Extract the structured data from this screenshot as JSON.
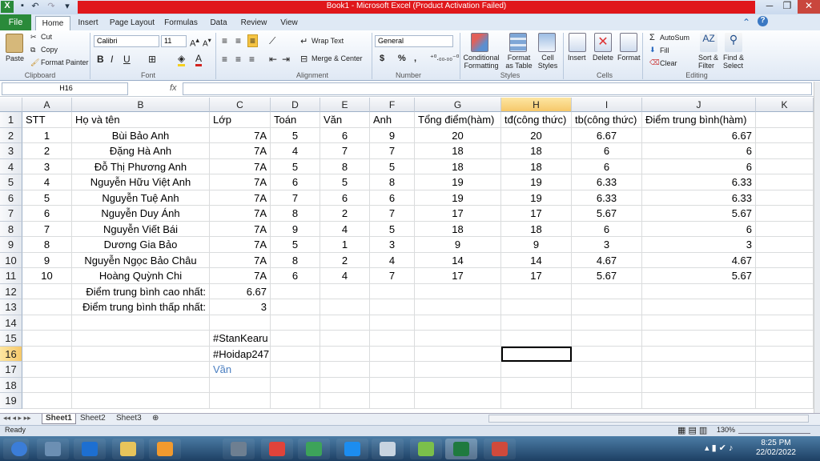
{
  "window": {
    "title": "Book1  -  Microsoft Excel (Product Activation Failed)",
    "minimize": "─",
    "restore": "❐",
    "close": "✕"
  },
  "ribbon_tabs": [
    "File",
    "Home",
    "Insert",
    "Page Layout",
    "Formulas",
    "Data",
    "Review",
    "View"
  ],
  "clipboard": {
    "paste": "Paste",
    "cut": "Cut",
    "copy": "Copy",
    "format_painter": "Format Painter",
    "label": "Clipboard"
  },
  "font": {
    "name": "Calibri",
    "size": "11",
    "bold": "B",
    "italic": "I",
    "underline": "U",
    "label": "Font"
  },
  "alignment": {
    "wrap": "Wrap Text",
    "merge": "Merge & Center",
    "label": "Alignment"
  },
  "number": {
    "format": "General",
    "currency": "$",
    "percent": "%",
    "comma": ",",
    "label": "Number"
  },
  "styles": {
    "conditional": "Conditional",
    "conditional2": "Formatting",
    "format_as": "Format",
    "format_as2": "as Table",
    "cell_styles": "Cell",
    "cell_styles2": "Styles",
    "label": "Styles"
  },
  "cells": {
    "insert": "Insert",
    "delete": "Delete",
    "format": "Format",
    "label": "Cells"
  },
  "editing": {
    "autosum": "AutoSum",
    "fill": "Fill",
    "clear": "Clear",
    "sort": "Sort &",
    "sort2": "Filter",
    "find": "Find &",
    "find2": "Select",
    "label": "Editing"
  },
  "formula_bar": {
    "name_box": "H16",
    "fx": "fx",
    "content": ""
  },
  "columns": [
    "A",
    "B",
    "C",
    "D",
    "E",
    "F",
    "G",
    "H",
    "I",
    "J",
    "K"
  ],
  "rows": [
    "1",
    "2",
    "3",
    "4",
    "5",
    "6",
    "7",
    "8",
    "9",
    "10",
    "11",
    "12",
    "13",
    "14",
    "15",
    "16",
    "17",
    "18",
    "19"
  ],
  "sheet": {
    "header": [
      "STT",
      "Họ và tên",
      "Lớp",
      "Toán",
      "Văn",
      "Anh",
      "Tổng điểm(hàm)",
      "tđ(công thức)",
      "tb(công thức)",
      "Điểm trung bình(hàm)"
    ],
    "data": [
      [
        "1",
        "Bùi Bảo Anh",
        "7A",
        "5",
        "6",
        "9",
        "20",
        "20",
        "6.67",
        "6.67"
      ],
      [
        "2",
        "Đặng Hà Anh",
        "7A",
        "4",
        "7",
        "7",
        "18",
        "18",
        "6",
        "6"
      ],
      [
        "3",
        "Đỗ Thị Phương Anh",
        "7A",
        "5",
        "8",
        "5",
        "18",
        "18",
        "6",
        "6"
      ],
      [
        "4",
        "Nguyễn Hữu Việt Anh",
        "7A",
        "6",
        "5",
        "8",
        "19",
        "19",
        "6.33",
        "6.33"
      ],
      [
        "5",
        "Nguyễn Tuệ Anh",
        "7A",
        "7",
        "6",
        "6",
        "19",
        "19",
        "6.33",
        "6.33"
      ],
      [
        "6",
        "Nguyễn Duy Ánh",
        "7A",
        "8",
        "2",
        "7",
        "17",
        "17",
        "5.67",
        "5.67"
      ],
      [
        "7",
        "Nguyễn Viết Bái",
        "7A",
        "9",
        "4",
        "5",
        "18",
        "18",
        "6",
        "6"
      ],
      [
        "8",
        "Dương Gia Bảo",
        "7A",
        "5",
        "1",
        "3",
        "9",
        "9",
        "3",
        "3"
      ],
      [
        "9",
        "Nguyễn Ngọc Bảo Châu",
        "7A",
        "8",
        "2",
        "4",
        "14",
        "14",
        "4.67",
        "4.67"
      ],
      [
        "10",
        "Hoàng Quỳnh Chi",
        "7A",
        "6",
        "4",
        "7",
        "17",
        "17",
        "5.67",
        "5.67"
      ]
    ],
    "max_label": "Điểm trung bình cao nhất:",
    "max_value": "6.67",
    "min_label": "Điểm trung bình thấp nhất:",
    "min_value": "3",
    "c15": "#StanKearu",
    "c16": "#Hoidap247",
    "c17": "Vần",
    "c17_color": "#4a7ec0"
  },
  "sheet_tabs": [
    "Sheet1",
    "Sheet2",
    "Sheet3"
  ],
  "status": {
    "ready": "Ready",
    "zoom": "130%"
  },
  "clock": {
    "time": "8:25 PM",
    "date": "22/02/2022"
  },
  "taskbar_icons": [
    "start-orb-icon",
    "computer-icon",
    "ie-icon",
    "folder-icon",
    "scratch-icon",
    "calculator-icon",
    "chrome-icon",
    "paint-people-icon",
    "zalo-icon",
    "paint-icon",
    "clock-app-icon",
    "excel-icon",
    "app-icon"
  ]
}
